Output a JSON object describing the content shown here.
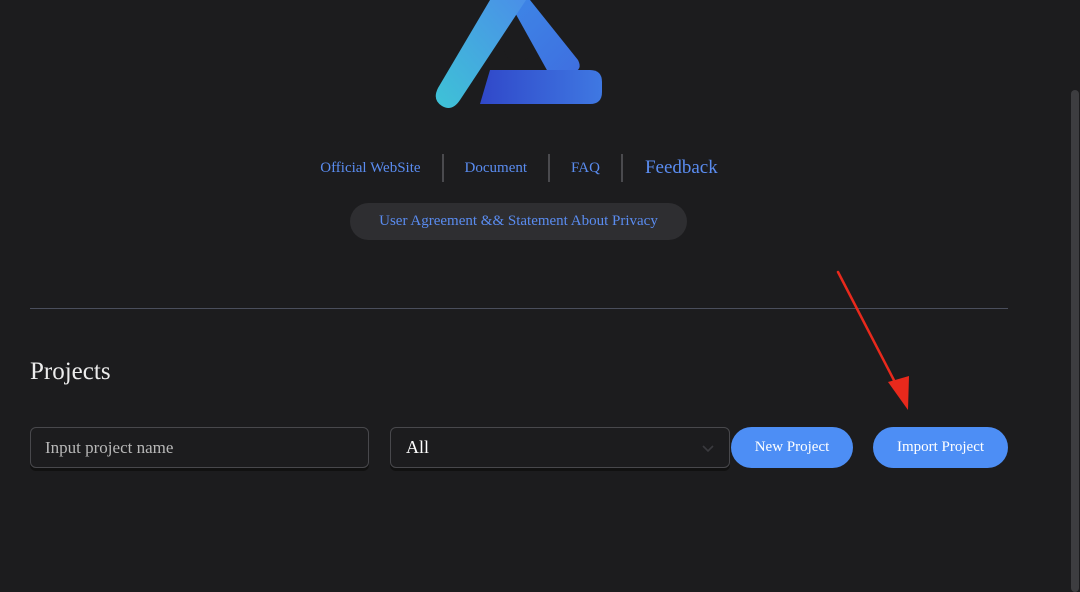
{
  "brand": {
    "logo_icon": "triangle-logo-icon",
    "colors": {
      "accent": "#4d8ef5",
      "link": "#5a8cf0",
      "background": "#1c1c1e",
      "annotation": "#e8291c"
    }
  },
  "nav_links": {
    "official_website": "Official WebSite",
    "document": "Document",
    "faq": "FAQ",
    "feedback": "Feedback"
  },
  "agreement": {
    "label": "User Agreement && Statement About Privacy"
  },
  "projects": {
    "title": "Projects",
    "search": {
      "placeholder": "Input project name",
      "value": ""
    },
    "filter": {
      "selected": "All",
      "icon": "chevron-down-icon"
    },
    "new_project_label": "New Project",
    "import_project_label": "Import Project"
  },
  "annotation": {
    "type": "red-arrow",
    "points_to": "import-project-button"
  }
}
